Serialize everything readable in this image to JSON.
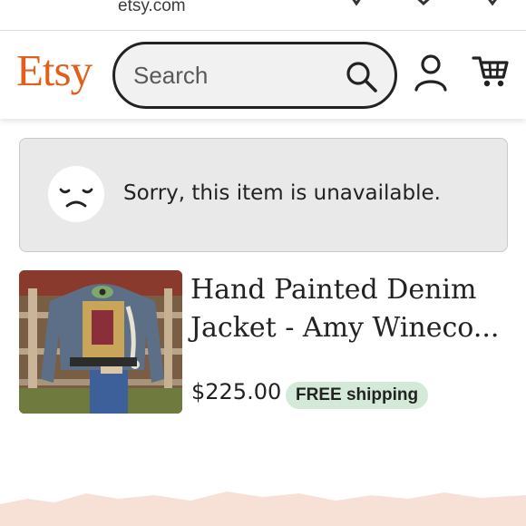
{
  "browser": {
    "url": "etsy.com"
  },
  "header": {
    "logo": "Etsy",
    "search": {
      "placeholder": "Search",
      "value": ""
    },
    "icons": [
      "search-icon",
      "account-icon",
      "cart-icon"
    ]
  },
  "notice": {
    "icon": "sad-face-icon",
    "message": "Sorry, this item is unavailable."
  },
  "listing": {
    "title_lines": [
      "Hand Painted Denim",
      "Jacket - Amy Wineco..."
    ],
    "price": "$225.00",
    "shipping_badge": "FREE shipping"
  },
  "colors": {
    "brand": "#e15f1b",
    "notice_bg": "#e9e9e9",
    "shipping_badge_bg": "#d4e9d7",
    "footer_band": "#f7e1d7"
  }
}
